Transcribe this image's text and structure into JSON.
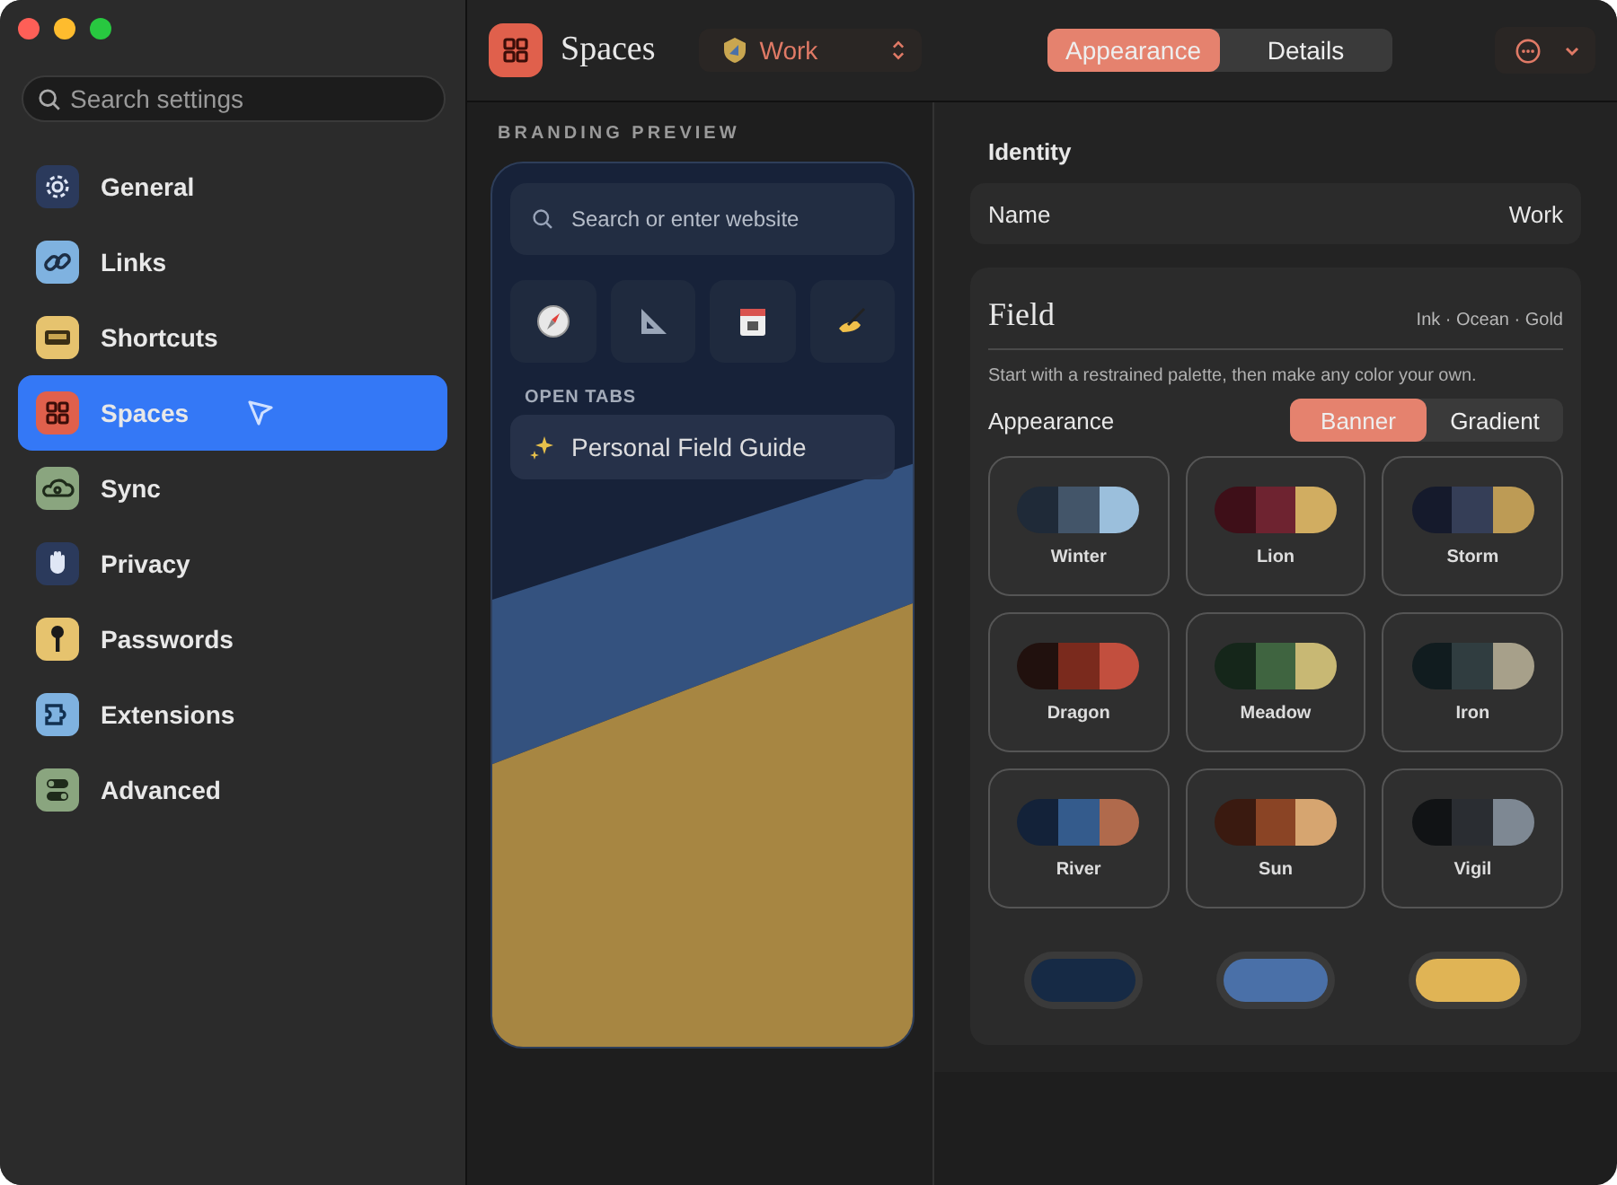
{
  "sidebar": {
    "search": {
      "placeholder": "Search settings"
    },
    "items": [
      {
        "label": "General",
        "color": "#2b3a5c",
        "selected": false
      },
      {
        "label": "Links",
        "color": "#7fb2e0",
        "selected": false
      },
      {
        "label": "Shortcuts",
        "color": "#e6c36e",
        "selected": false
      },
      {
        "label": "Spaces",
        "color": "#e0604c",
        "selected": true
      },
      {
        "label": "Sync",
        "color": "#8aa57f",
        "selected": false
      },
      {
        "label": "Privacy",
        "color": "#2b3a5c",
        "selected": false
      },
      {
        "label": "Passwords",
        "color": "#e6c36e",
        "selected": false
      },
      {
        "label": "Extensions",
        "color": "#7fb2e0",
        "selected": false
      },
      {
        "label": "Advanced",
        "color": "#8aa57f",
        "selected": false
      }
    ]
  },
  "header": {
    "title": "Spaces",
    "space": "Work",
    "tabs": [
      {
        "label": "Appearance",
        "selected": true
      },
      {
        "label": "Details",
        "selected": false
      }
    ]
  },
  "preview": {
    "heading": "BRANDING PREVIEW",
    "search": {
      "placeholder": "Search or enter website"
    },
    "open_tabs_heading": "OPEN TABS",
    "open_tab": "Personal Field Guide"
  },
  "identity": {
    "heading": "Identity",
    "name_label": "Name",
    "name_value": "Work"
  },
  "field": {
    "title": "Field",
    "subtitle": "Ink · Ocean · Gold",
    "description": "Start with a restrained palette, then make any color your own.",
    "appearance_label": "Appearance",
    "modes": [
      {
        "label": "Banner",
        "selected": true
      },
      {
        "label": "Gradient",
        "selected": false
      }
    ],
    "palettes": [
      {
        "name": "Winter",
        "swatches": [
          {
            "color": "#1f2a38"
          },
          {
            "color": "#435569"
          },
          {
            "color": "#9bbfdc"
          }
        ]
      },
      {
        "name": "Lion",
        "swatches": [
          {
            "color": "#3e0f18"
          },
          {
            "color": "#6e2330"
          },
          {
            "color": "#d1ad61"
          }
        ]
      },
      {
        "name": "Storm",
        "swatches": [
          {
            "color": "#151a2c"
          },
          {
            "color": "#353e57"
          },
          {
            "color": "#bd9b55"
          }
        ]
      },
      {
        "name": "Dragon",
        "swatches": [
          {
            "color": "#21110e"
          },
          {
            "color": "#7a2a1d"
          },
          {
            "color": "#c24f3e"
          }
        ]
      },
      {
        "name": "Meadow",
        "swatches": [
          {
            "color": "#15261a"
          },
          {
            "color": "#3f6440"
          },
          {
            "color": "#c8b874"
          }
        ]
      },
      {
        "name": "Iron",
        "swatches": [
          {
            "color": "#111c1f"
          },
          {
            "color": "#303d40"
          },
          {
            "color": "#a7a08a"
          }
        ]
      },
      {
        "name": "River",
        "swatches": [
          {
            "color": "#132239"
          },
          {
            "color": "#345b8c"
          },
          {
            "color": "#b06a4c"
          }
        ]
      },
      {
        "name": "Sun",
        "swatches": [
          {
            "color": "#3a1a10"
          },
          {
            "color": "#8a4425"
          },
          {
            "color": "#d6a570"
          }
        ]
      },
      {
        "name": "Vigil",
        "swatches": [
          {
            "color": "#111315"
          },
          {
            "color": "#2a2d32"
          },
          {
            "color": "#7e8893"
          }
        ]
      }
    ],
    "accents": [
      {
        "color": "#162a45"
      },
      {
        "color": "#4a70a8"
      },
      {
        "color": "#e0b455"
      }
    ]
  }
}
